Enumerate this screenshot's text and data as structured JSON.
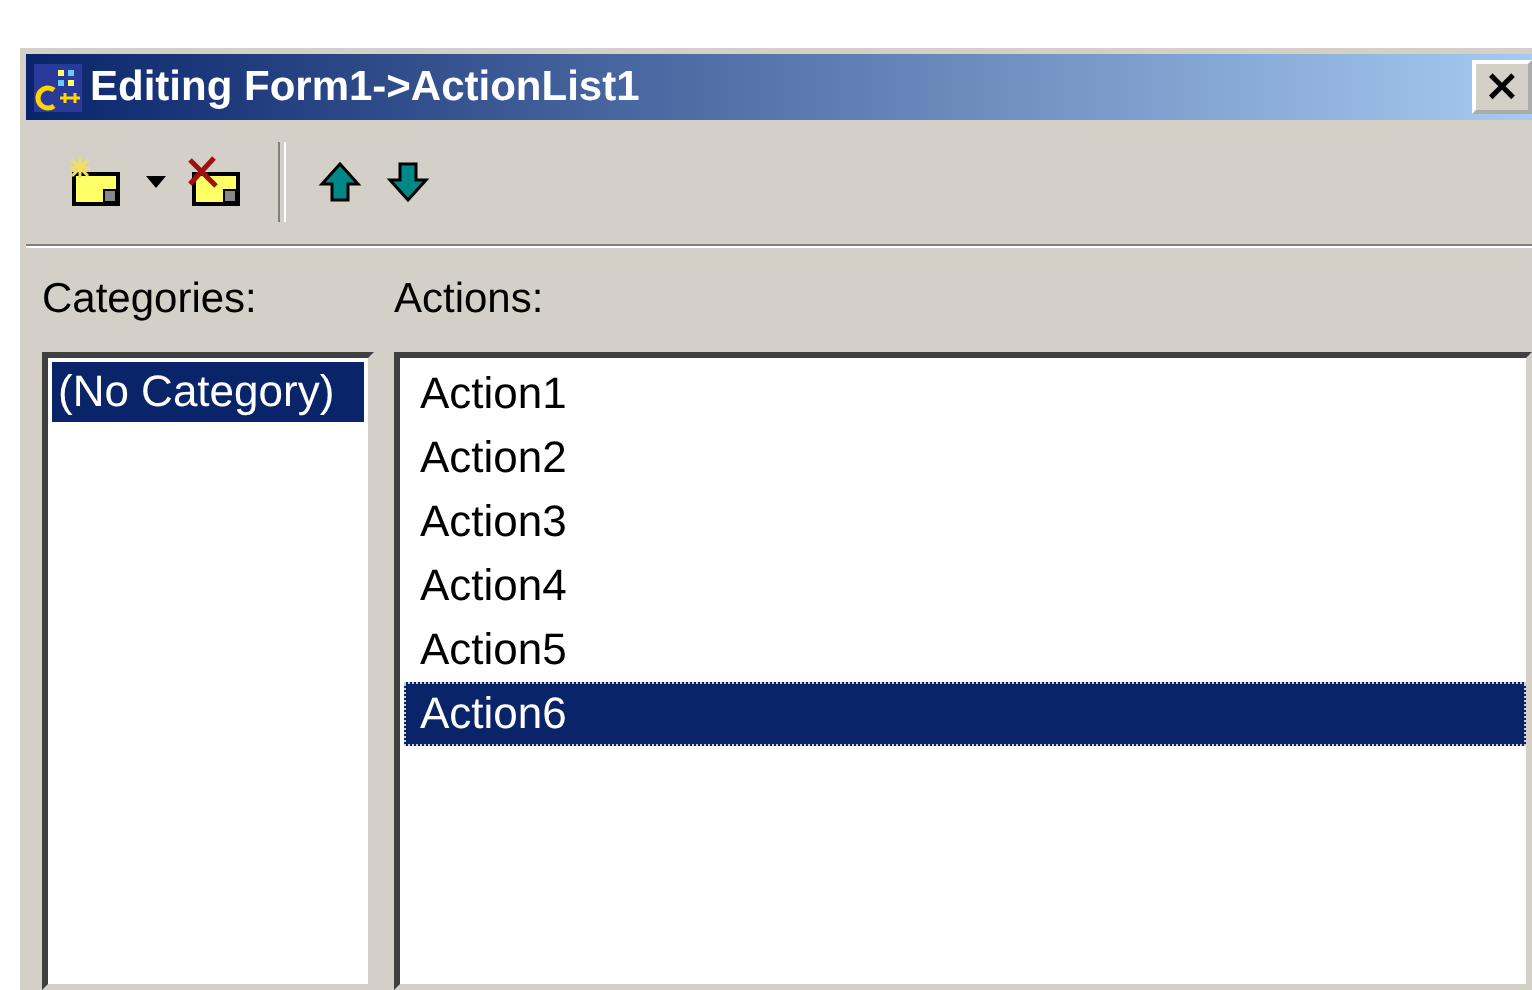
{
  "window": {
    "title": "Editing Form1->ActionList1",
    "close_label": "×"
  },
  "toolbar": [
    {
      "kind": "new"
    },
    {
      "kind": "dropdown"
    },
    {
      "kind": "delete"
    },
    {
      "kind": "separator"
    },
    {
      "kind": "up"
    },
    {
      "kind": "down"
    }
  ],
  "categories": {
    "label": "Categories:",
    "items": [
      {
        "text": "(No Category)",
        "selected": true
      }
    ]
  },
  "actions": {
    "label": "Actions:",
    "items": [
      {
        "text": "Action1",
        "selected": false
      },
      {
        "text": "Action2",
        "selected": false
      },
      {
        "text": "Action3",
        "selected": false
      },
      {
        "text": "Action4",
        "selected": false
      },
      {
        "text": "Action5",
        "selected": false
      },
      {
        "text": "Action6",
        "selected": true
      }
    ]
  }
}
